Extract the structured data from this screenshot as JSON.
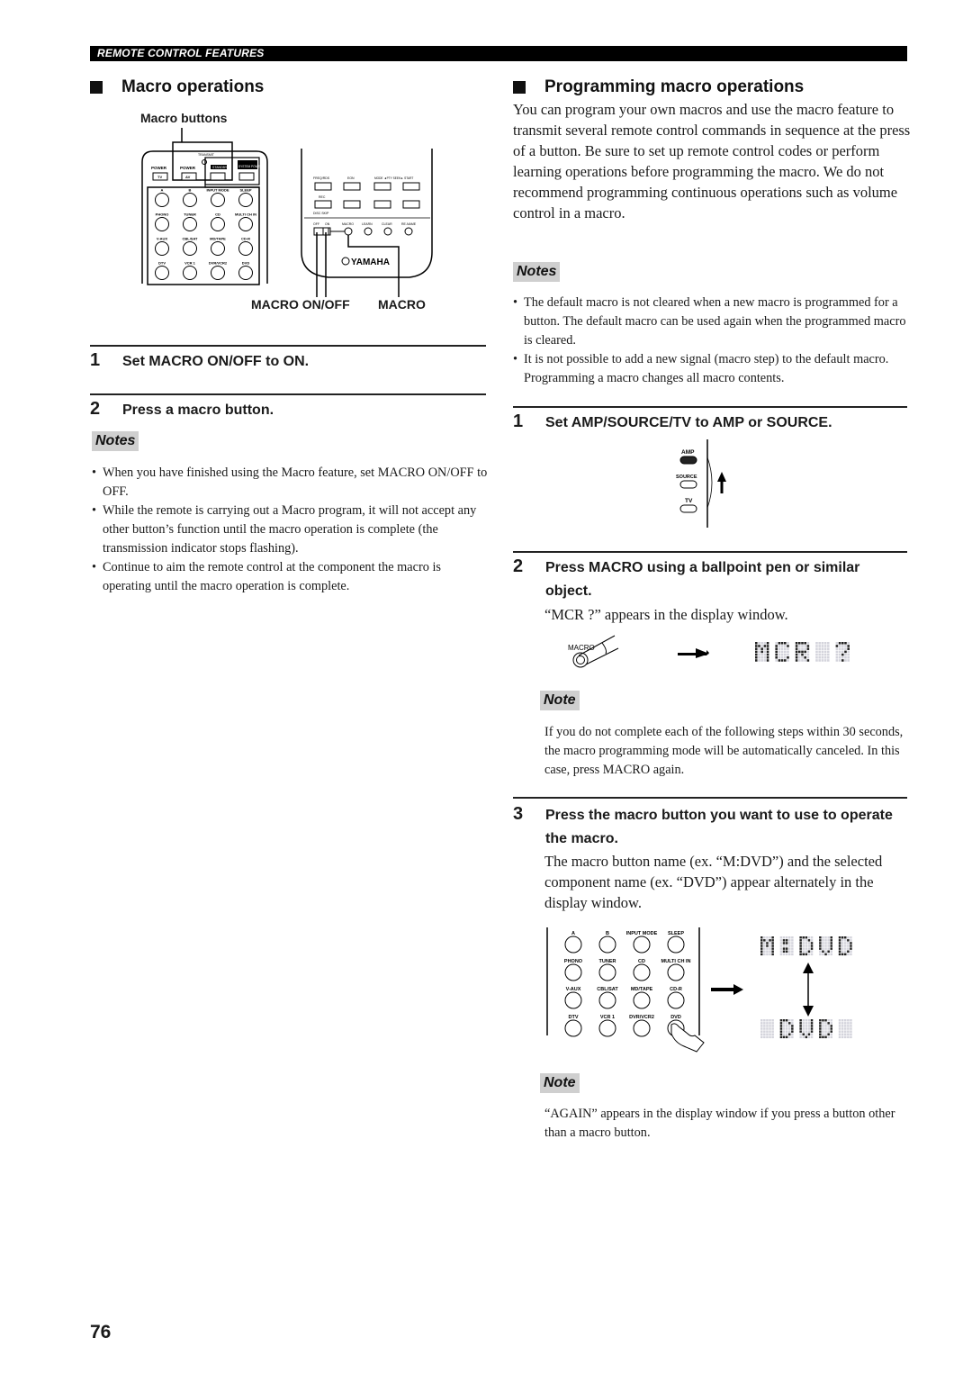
{
  "header": {
    "section_title": "REMOTE CONTROL FEATURES"
  },
  "left": {
    "heading": "Macro operations",
    "figure": {
      "callout_top": "Macro buttons",
      "callout_bottom_left": "MACRO ON/OFF",
      "callout_bottom_right": "MACRO",
      "remote_labels": {
        "transmit": "TRANSMIT",
        "power_tv": "POWER",
        "tv": "TV",
        "power_av": "POWER",
        "av": "AV",
        "standby": "STANDBY",
        "system_power": "SYSTEM POWER",
        "a": "A",
        "b": "B",
        "input_mode": "INPUT MODE",
        "sleep": "SLEEP",
        "phono": "PHONO",
        "tuner": "TUNER",
        "cd": "CD",
        "multi_ch_in": "MULTI CH IN",
        "v_aux": "V-AUX",
        "cbl_sat": "CBL/SAT",
        "md_tape": "MD/TAPE",
        "cd_r": "CD-R",
        "dtv": "DTV",
        "vcr1": "VCR 1",
        "dvr_vcr2": "DVR/VCR2",
        "dvd": "DVD",
        "freq_rds": "FREQ/RDS",
        "eon": "EON",
        "mode_pty": "MODE ◄PTY SEEK► START",
        "rec": "REC",
        "disc_skip": "DISC SKIP",
        "off": "OFF",
        "on": "ON",
        "macro": "MACRO",
        "learn": "LEARN",
        "clear": "CLEAR",
        "rename": "RE-NAME",
        "brand": "YAMAHA"
      }
    },
    "steps": [
      {
        "num": "1",
        "text": "Set MACRO ON/OFF to ON."
      },
      {
        "num": "2",
        "text": "Press a macro button."
      }
    ],
    "notes_label": "Notes",
    "notes": [
      "When you have finished using the Macro feature, set MACRO ON/OFF to OFF.",
      "While the remote is carrying out a Macro program, it will not accept any other button’s function until the macro operation is complete (the transmission indicator stops flashing).",
      "Continue to aim the remote control at the component the macro is operating until the macro operation is complete."
    ]
  },
  "right": {
    "heading": "Programming macro operations",
    "intro": "You can program your own macros and use the macro feature to transmit several remote control commands in sequence at the press of a button. Be sure to set up remote control codes or perform learning operations before programming the macro. We do not recommend programming continuous operations such as volume control in a macro.",
    "notes_label": "Notes",
    "notes": [
      "The default macro is not cleared when a new macro is programmed for a button. The default macro can be used again when the programmed macro is cleared.",
      "It is not possible to add a new signal (macro step) to the default macro. Programming a macro changes all macro contents."
    ],
    "step1": {
      "num": "1",
      "text": "Set AMP/SOURCE/TV to AMP or SOURCE.",
      "switch_labels": {
        "amp": "AMP",
        "source": "SOURCE",
        "tv": "TV"
      }
    },
    "step2": {
      "num": "2",
      "text": "Press MACRO using a ballpoint pen or similar object.",
      "desc": "“MCR ?” appears in the display window.",
      "button_label": "MACRO",
      "display": "MCR ?"
    },
    "note1_label": "Note",
    "note1": "If you do not complete each of the following steps within 30 seconds, the macro programming mode will be automatically canceled. In this case, press MACRO again.",
    "step3": {
      "num": "3",
      "text": "Press the macro button you want to use to operate the macro.",
      "desc": "The macro button name (ex. “M:DVD”) and the selected component name (ex. “DVD”) appear alternately in the display window.",
      "display_top": "M:DVD",
      "display_bottom": " DVD "
    },
    "note2_label": "Note",
    "note2": "“AGAIN” appears in the display window if you press a button other than a macro button."
  },
  "footer": {
    "page_number": "76"
  }
}
